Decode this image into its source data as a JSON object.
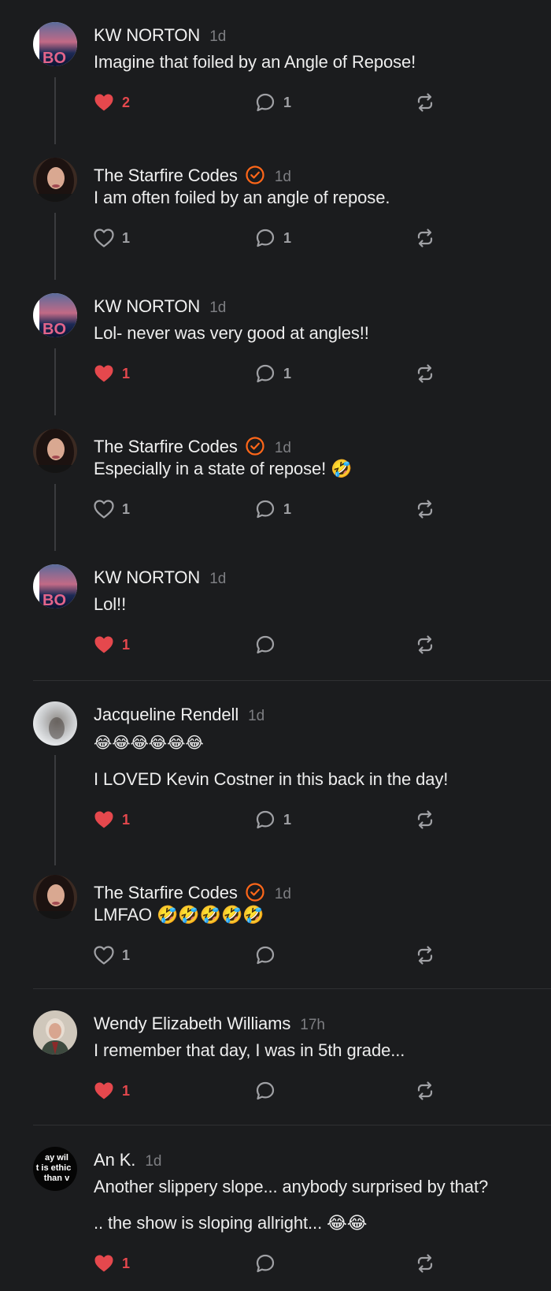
{
  "colors": {
    "background": "#1b1c1e",
    "liked": "#e5484d",
    "verified": "#ff6719",
    "muted": "#7d7e82"
  },
  "comments": [
    {
      "author": "KW NORTON",
      "time": "1d",
      "verified": false,
      "avatar": "kw-norton-avatar",
      "lines": [
        "Imagine that foiled by an Angle of Repose!"
      ],
      "likes": "2",
      "liked": true,
      "replies": "1"
    },
    {
      "author": "The Starfire Codes",
      "time": "1d",
      "verified": true,
      "avatar": "starfire-avatar",
      "lines": [
        "I am often foiled by an angle of repose."
      ],
      "likes": "1",
      "liked": false,
      "replies": "1"
    },
    {
      "author": "KW NORTON",
      "time": "1d",
      "verified": false,
      "avatar": "kw-norton-avatar",
      "lines": [
        "Lol- never was very good at angles!!"
      ],
      "likes": "1",
      "liked": true,
      "replies": "1"
    },
    {
      "author": "The Starfire Codes",
      "time": "1d",
      "verified": true,
      "avatar": "starfire-avatar",
      "lines": [
        "Especially in a state of repose! 🤣"
      ],
      "likes": "1",
      "liked": false,
      "replies": "1"
    },
    {
      "author": "KW NORTON",
      "time": "1d",
      "verified": false,
      "avatar": "kw-norton-avatar",
      "lines": [
        "Lol!!"
      ],
      "likes": "1",
      "liked": true,
      "replies": ""
    },
    {
      "author": "Jacqueline Rendell",
      "time": "1d",
      "verified": false,
      "avatar": "jacqueline-avatar",
      "lines": [
        "😂😂😂😂😂😂",
        "I LOVED Kevin Costner in this back in the day!"
      ],
      "likes": "1",
      "liked": true,
      "replies": "1"
    },
    {
      "author": "The Starfire Codes",
      "time": "1d",
      "verified": true,
      "avatar": "starfire-avatar",
      "lines": [
        "LMFAO 🤣🤣🤣🤣🤣"
      ],
      "likes": "1",
      "liked": false,
      "replies": ""
    },
    {
      "author": "Wendy Elizabeth Williams",
      "time": "17h",
      "verified": false,
      "avatar": "wendy-avatar",
      "lines": [
        "I remember that day, I was in 5th grade..."
      ],
      "likes": "1",
      "liked": true,
      "replies": ""
    },
    {
      "author": "An K.",
      "time": "1d",
      "verified": false,
      "avatar": "an-k-avatar",
      "avatar_text": [
        "ay wil",
        "t is ethic",
        "than v"
      ],
      "lines": [
        "Another slippery slope... anybody surprised by that?",
        ".. the show is sloping allright... 😂😂"
      ],
      "likes": "1",
      "liked": true,
      "replies": ""
    }
  ]
}
